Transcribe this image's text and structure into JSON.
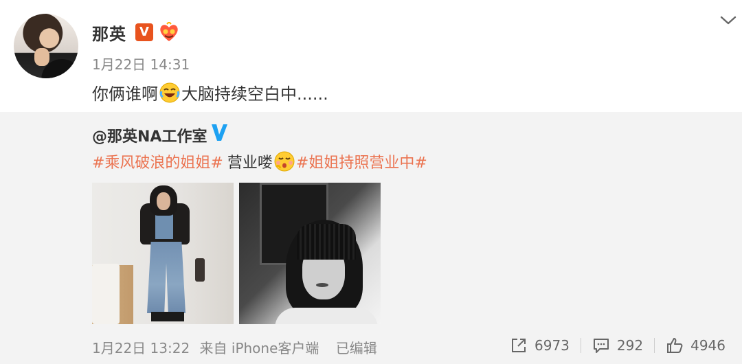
{
  "post": {
    "username": "那英",
    "verified_badge": "V",
    "timestamp": "1月22日 14:31",
    "text_before": "你俩谁啊",
    "emoji_1": "laughing-crying-emoji",
    "text_after": "大脑持续空白中......"
  },
  "repost": {
    "author": "@那英NA工作室",
    "hashtag_1": "#乘风破浪的姐姐#",
    "text_middle": "营业喽",
    "emoji_2": "shy-kiss-emoji",
    "hashtag_2": "#姐姐持照营业中#",
    "images": [
      "photo-fashion-denim",
      "photo-bw-portrait"
    ],
    "meta_time": "1月22日 13:22",
    "meta_source": "来自 iPhone客户端",
    "meta_edited": "已编辑",
    "repost_count": "6973",
    "comment_count": "292",
    "like_count": "4946"
  },
  "colors": {
    "accent_hashtag": "#eb7350",
    "verified_orange": "#e8531e",
    "verified_blue": "#1da1f2",
    "repost_bg": "#f3f3f3"
  }
}
